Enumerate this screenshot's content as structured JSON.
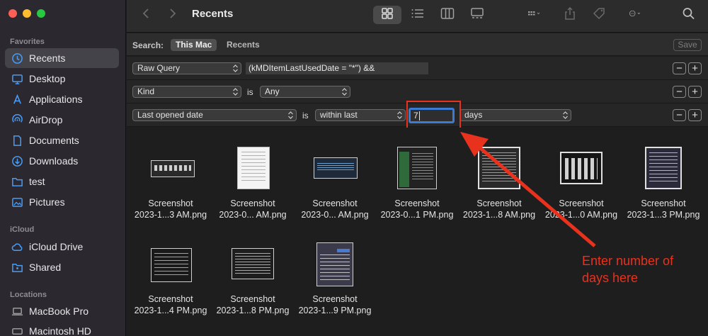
{
  "sidebar": {
    "sections": [
      {
        "title": "Favorites",
        "items": [
          {
            "label": "Recents",
            "icon": "clock-icon",
            "active": true
          },
          {
            "label": "Desktop",
            "icon": "desktop-icon"
          },
          {
            "label": "Applications",
            "icon": "applications-icon"
          },
          {
            "label": "AirDrop",
            "icon": "airdrop-icon"
          },
          {
            "label": "Documents",
            "icon": "document-icon"
          },
          {
            "label": "Downloads",
            "icon": "download-icon"
          },
          {
            "label": "test",
            "icon": "folder-icon"
          },
          {
            "label": "Pictures",
            "icon": "pictures-icon"
          }
        ]
      },
      {
        "title": "iCloud",
        "items": [
          {
            "label": "iCloud Drive",
            "icon": "cloud-icon"
          },
          {
            "label": "Shared",
            "icon": "shared-folder-icon"
          }
        ]
      },
      {
        "title": "Locations",
        "items": [
          {
            "label": "MacBook Pro",
            "icon": "laptop-icon"
          },
          {
            "label": "Macintosh HD",
            "icon": "disk-icon"
          }
        ]
      }
    ]
  },
  "toolbar": {
    "title": "Recents",
    "icons": [
      "back-icon",
      "forward-icon",
      "icon-view-icon",
      "list-view-icon",
      "column-view-icon",
      "gallery-view-icon",
      "group-icon",
      "share-icon",
      "tag-icon",
      "action-icon",
      "search-icon"
    ]
  },
  "search": {
    "label": "Search:",
    "scopes": [
      "This Mac",
      "Recents"
    ],
    "save_label": "Save"
  },
  "criteria": {
    "row1": {
      "attribute": "Raw Query",
      "query": "(kMDItemLastUsedDate = \"*\") &&"
    },
    "row2": {
      "attribute": "Kind",
      "operator": "is",
      "value": "Any"
    },
    "row3": {
      "attribute": "Last opened date",
      "operator": "is",
      "condition": "within last",
      "amount": "7",
      "unit": "days"
    }
  },
  "files": [
    {
      "line1": "Screenshot",
      "line2": "2023-1...3 AM.png"
    },
    {
      "line1": "Screenshot",
      "line2": "2023-0... AM.png"
    },
    {
      "line1": "Screenshot",
      "line2": "2023-0... AM.png"
    },
    {
      "line1": "Screenshot",
      "line2": "2023-0...1 PM.png"
    },
    {
      "line1": "Screenshot",
      "line2": "2023-1...8 AM.png"
    },
    {
      "line1": "Screenshot",
      "line2": "2023-1...0 AM.png"
    },
    {
      "line1": "Screenshot",
      "line2": "2023-1...3 PM.png"
    },
    {
      "line1": "Screenshot",
      "line2": "2023-1...4 PM.png"
    },
    {
      "line1": "Screenshot",
      "line2": "2023-1...8 PM.png"
    },
    {
      "line1": "Screenshot",
      "line2": "2023-1...9 PM.png"
    }
  ],
  "annotation": {
    "text_line1": "Enter number of",
    "text_line2": "days here",
    "color": "#e8321e"
  },
  "colors": {
    "accent": "#3a7bd5",
    "sidebar_bg": "#2b2830",
    "content_bg": "#1e1e1e"
  }
}
